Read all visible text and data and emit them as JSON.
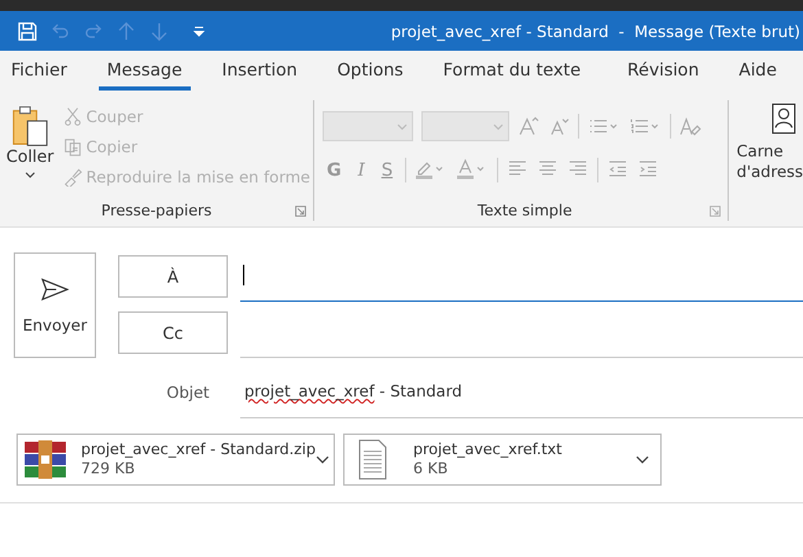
{
  "title_bar": {
    "title": "projet_avec_xref - Standard  -  Message (Texte brut)"
  },
  "tabs": [
    {
      "label": "Fichier",
      "selected": false
    },
    {
      "label": "Message",
      "selected": true
    },
    {
      "label": "Insertion",
      "selected": false
    },
    {
      "label": "Options",
      "selected": false
    },
    {
      "label": "Format du texte",
      "selected": false
    },
    {
      "label": "Révision",
      "selected": false
    },
    {
      "label": "Aide",
      "selected": false
    }
  ],
  "clipboard": {
    "paste": "Coller",
    "label": "Presse-papiers",
    "items": [
      {
        "kind": "cut",
        "label": "Couper",
        "disabled": true
      },
      {
        "kind": "copy",
        "label": "Copier",
        "disabled": true
      },
      {
        "kind": "format-painter",
        "label": "Reproduire la mise en forme",
        "disabled": true
      }
    ]
  },
  "basic_text": {
    "label": "Texte simple",
    "style_buttons": [
      "G",
      "I",
      "S"
    ]
  },
  "address_book": {
    "label_lines": [
      "Carne",
      "d'adress"
    ]
  },
  "compose": {
    "send": "Envoyer",
    "to": "À",
    "cc": "Cc",
    "subject_label": "Objet",
    "subject": "projet_avec_xref - Standard"
  },
  "attachments": [
    {
      "kind": "zip",
      "name": "projet_avec_xref - Standard.zip",
      "size": "729 KB"
    },
    {
      "kind": "txt",
      "name": "projet_avec_xref.txt",
      "size": "6 KB"
    }
  ]
}
